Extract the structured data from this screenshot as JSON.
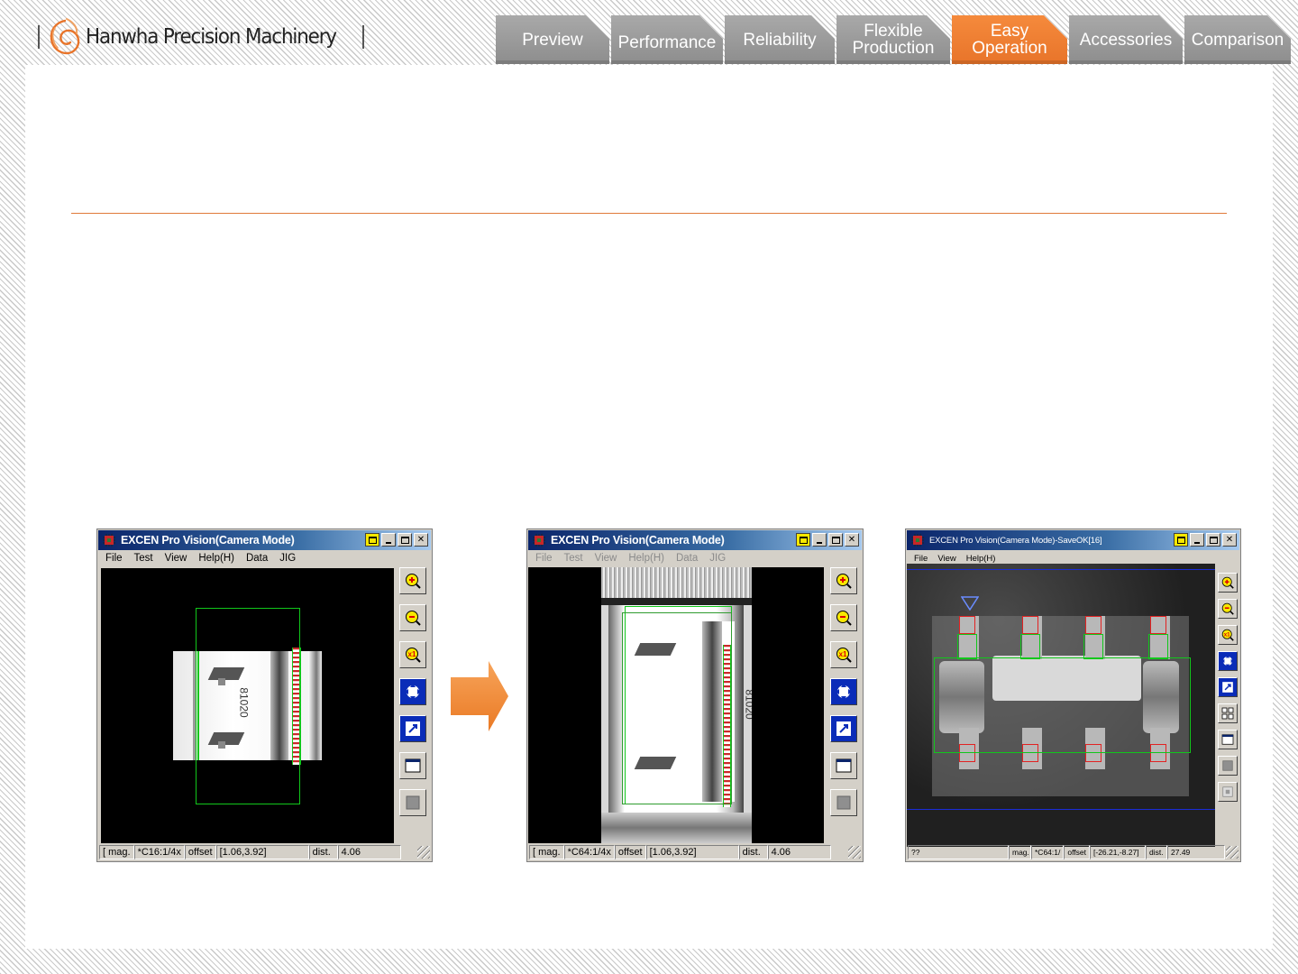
{
  "brand": {
    "name": "Hanwha Precision Machinery"
  },
  "nav": {
    "tabs": [
      {
        "label": "Preview",
        "active": false,
        "w": 0
      },
      {
        "label": "Performance",
        "active": false
      },
      {
        "label": "Reliability",
        "active": false
      },
      {
        "label": "Flexible\nProduction",
        "active": false
      },
      {
        "label": "Easy\nOperation",
        "active": true
      },
      {
        "label": "Accessories",
        "active": false
      },
      {
        "label": "Comparison",
        "active": false
      }
    ]
  },
  "colors": {
    "accent": "#e8742a",
    "tab": "#999999",
    "green_overlay": "#11c71b",
    "red_overlay": "#e22222"
  },
  "windows": [
    {
      "title": "EXCEN Pro Vision(Camera Mode)",
      "menu": [
        "File",
        "Test",
        "View",
        "Help(H)",
        "Data",
        "JIG"
      ],
      "part_marking": "81020",
      "status": {
        "mag_label": "[ mag.",
        "mag_value": "*C16:1/4x",
        "offset_label": "offset",
        "offset_value": "[1.06,3.92]",
        "dist_label": "dist.",
        "dist_value": "4.06"
      }
    },
    {
      "title": "EXCEN Pro Vision(Camera Mode)",
      "menu": [
        "File",
        "Test",
        "View",
        "Help(H)",
        "Data",
        "JIG"
      ],
      "part_marking": "81020",
      "status": {
        "mag_label": "[ mag.",
        "mag_value": "*C64:1/4x",
        "offset_label": "offset",
        "offset_value": "[1.06,3.92]",
        "dist_label": "dist.",
        "dist_value": "4.06"
      }
    },
    {
      "title": "EXCEN Pro Vision(Camera Mode)-SaveOK[16]",
      "menu": [
        "File",
        "View",
        "Help(H)"
      ],
      "status": {
        "first": "??",
        "mag_label": "mag.",
        "mag_value": "*C64:1/",
        "offset_label": "offset",
        "offset_value": "[-26.21,-8.27]",
        "dist_label": "dist.",
        "dist_value": "27.49"
      }
    }
  ],
  "toolbar_icons": [
    "zoom-in-icon",
    "zoom-out-icon",
    "zoom-x1-icon",
    "fit-view-icon",
    "expand-icon",
    "window-icon",
    "stop-icon"
  ],
  "transition_arrow": "right-arrow-icon"
}
